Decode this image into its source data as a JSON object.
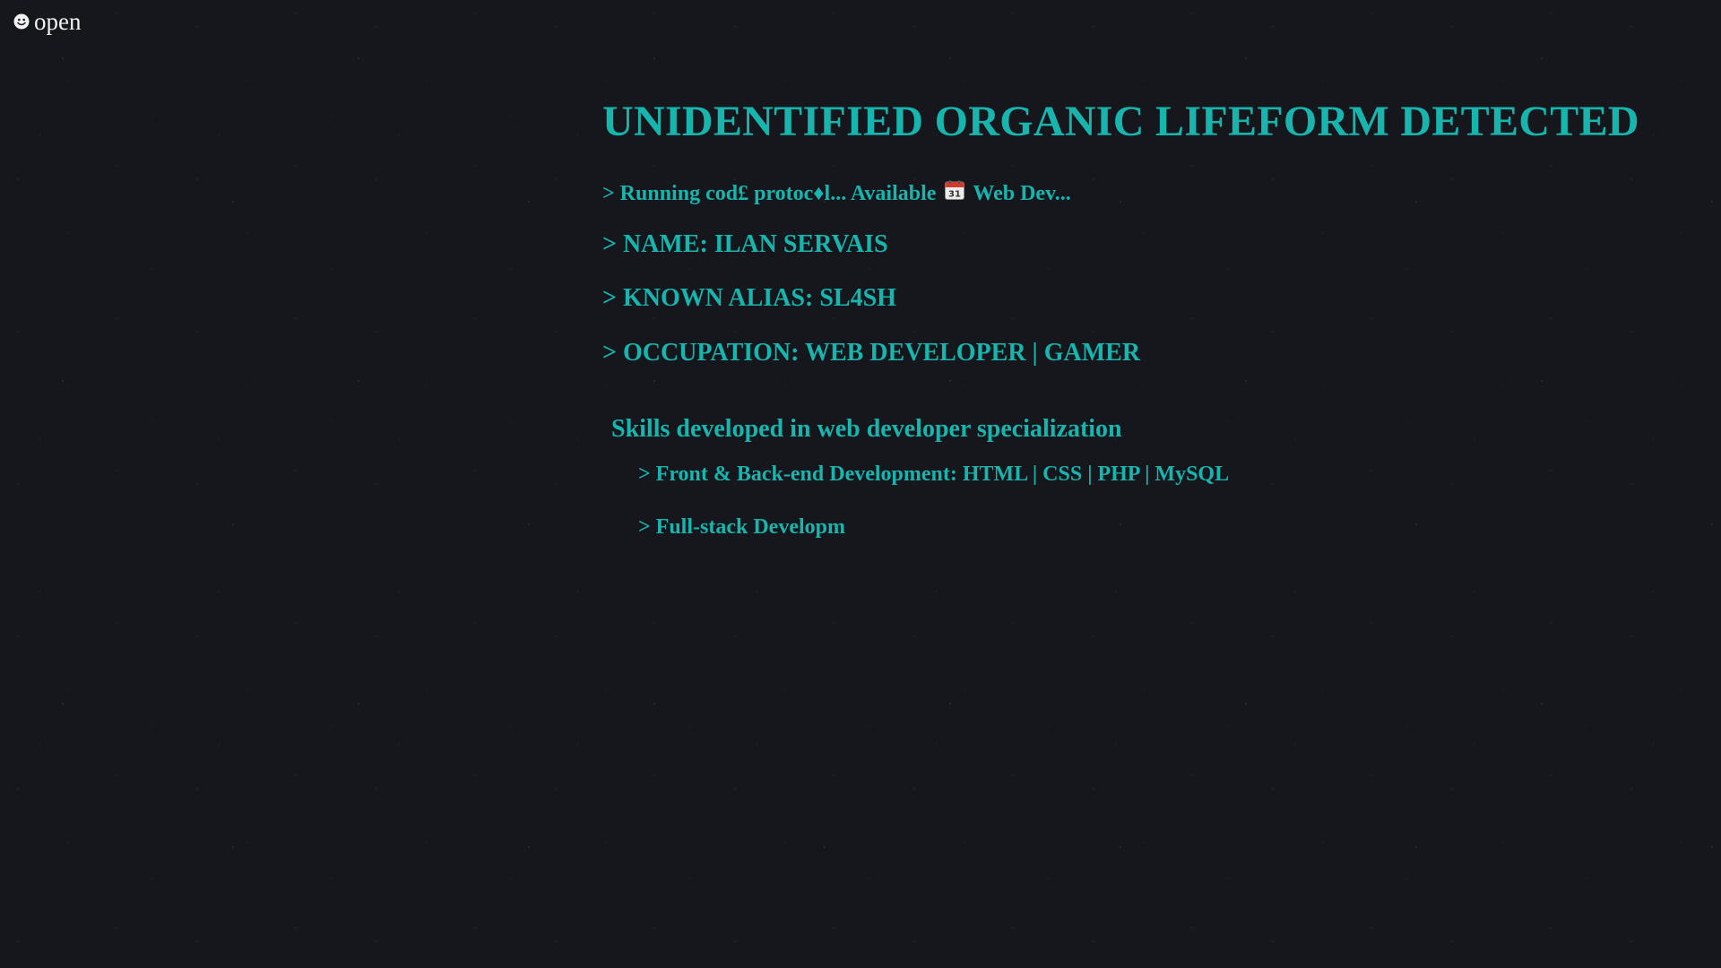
{
  "topbar": {
    "open_icon": "smiley-face-icon",
    "open_label": "open"
  },
  "terminal": {
    "headline": "UNIDENTIFIED ORGANIC LIFEFORM DETECTED",
    "status": {
      "prefix": "> Running cod£ protoc♦l... Available",
      "icon": "calendar-icon",
      "calendar_day": "31",
      "suffix": "Web Dev..."
    },
    "name_line": "> NAME: ILAN SERVAIS",
    "alias_line": "> KNOWN ALIAS: SL4SH",
    "occupation_line": "> OCCUPATION: WEB DEVELOPER | GAMER"
  },
  "skills": {
    "title": "Skills developed in web developer specialization",
    "items": [
      "> Front & Back-end Development: HTML | CSS | PHP | MySQL",
      "> Full-stack Developm"
    ]
  },
  "colors": {
    "background": "#15171d",
    "accent": "#17b5ad",
    "label": "#f2f2f2"
  }
}
